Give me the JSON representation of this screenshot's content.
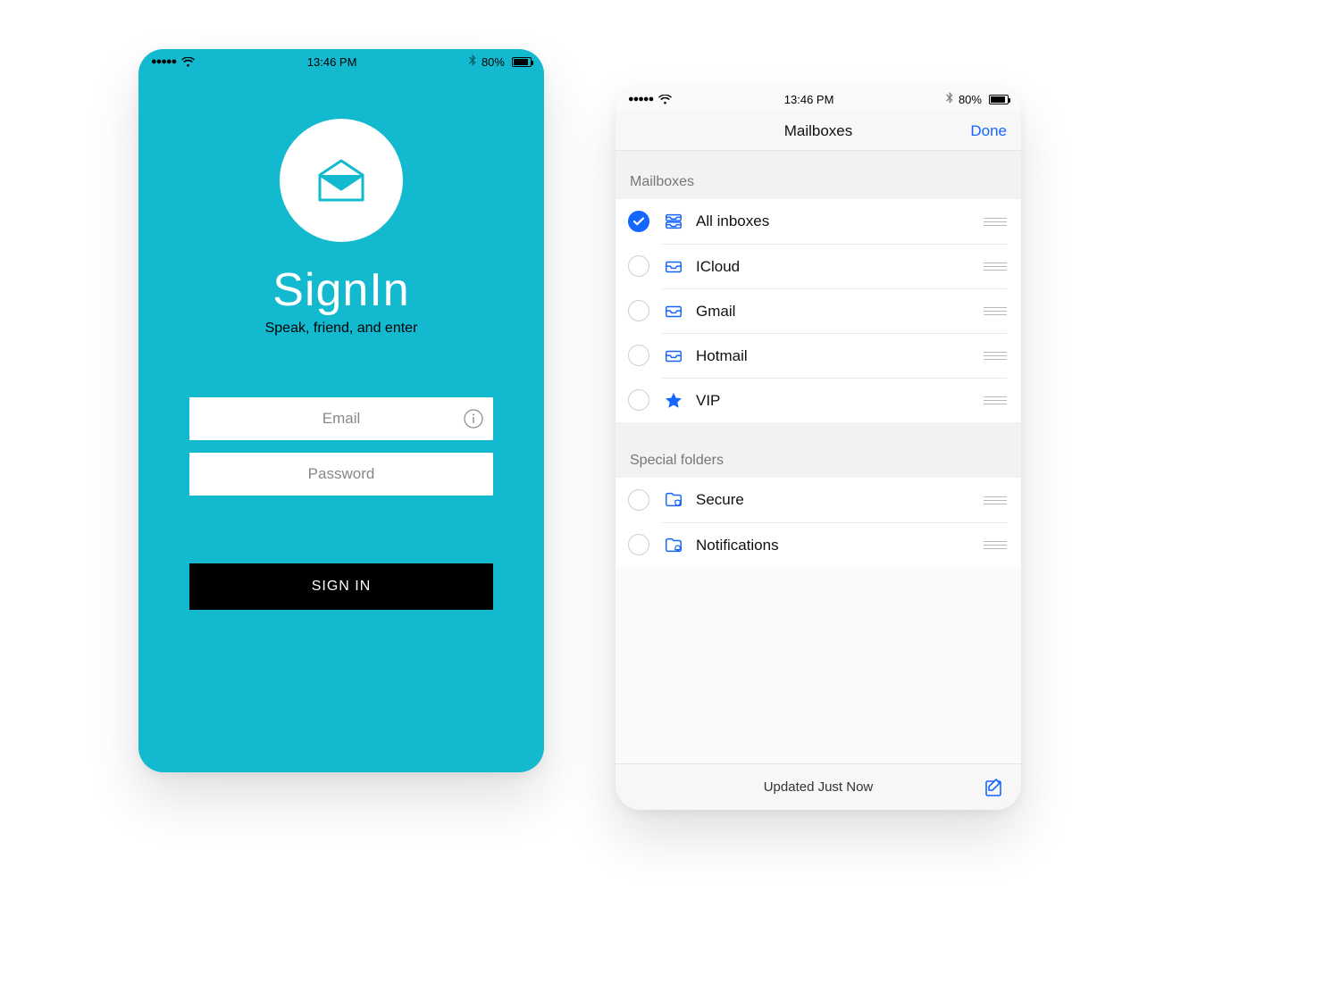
{
  "status": {
    "time": "13:46 PM",
    "battery": "80%"
  },
  "signin": {
    "title": "SignIn",
    "subtitle": "Speak, friend, and enter",
    "email_placeholder": "Email",
    "password_placeholder": "Password",
    "button": "SIGN IN"
  },
  "mail": {
    "nav_title": "Mailboxes",
    "done": "Done",
    "section1": "Mailboxes",
    "section2": "Special folders",
    "items": [
      {
        "label": "All inboxes",
        "checked": true,
        "icon": "inbox-stack"
      },
      {
        "label": "ICloud",
        "checked": false,
        "icon": "inbox"
      },
      {
        "label": "Gmail",
        "checked": false,
        "icon": "inbox"
      },
      {
        "label": "Hotmail",
        "checked": false,
        "icon": "inbox"
      },
      {
        "label": "VIP",
        "checked": false,
        "icon": "star"
      }
    ],
    "special": [
      {
        "label": "Secure",
        "icon": "folder-shield"
      },
      {
        "label": "Notifications",
        "icon": "folder-bell"
      }
    ],
    "footer": "Updated Just Now"
  },
  "colors": {
    "accent_teal": "#12b9cf",
    "accent_blue": "#1565ff"
  }
}
